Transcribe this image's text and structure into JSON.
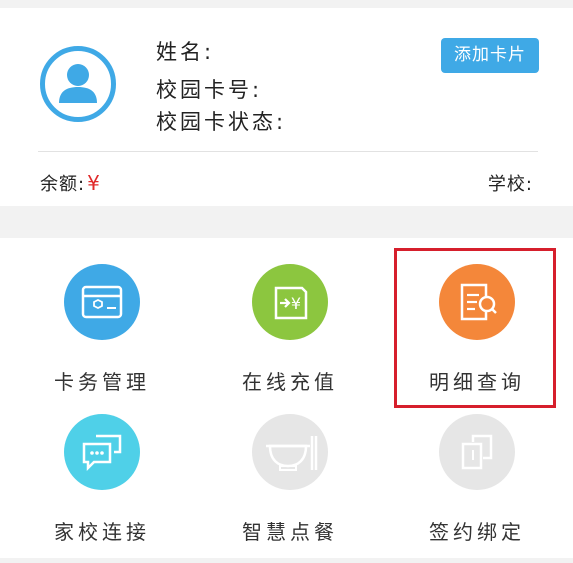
{
  "profile": {
    "name_label": "姓名:",
    "card_no_label": "校园卡号:",
    "card_status_label": "校园卡状态:",
    "add_card_button": "添加卡片",
    "balance_label": "余额:",
    "currency_symbol": "¥",
    "school_label": "学校:"
  },
  "menu": {
    "items": [
      {
        "label": "卡务管理",
        "icon": "card-icon",
        "color": "#3fa9e6"
      },
      {
        "label": "在线充值",
        "icon": "recharge-icon",
        "color": "#8cc63f"
      },
      {
        "label": "明细查询",
        "icon": "details-search-icon",
        "color": "#f4873a"
      },
      {
        "label": "家校连接",
        "icon": "chat-icon",
        "color": "#4fd0e8"
      },
      {
        "label": "智慧点餐",
        "icon": "meal-icon",
        "color": "#e6e6e6"
      },
      {
        "label": "签约绑定",
        "icon": "link-icon",
        "color": "#e6e6e6"
      }
    ]
  },
  "colors": {
    "accent": "#3fa9e6",
    "currency": "#e02a2a",
    "highlight_border": "#d61f2c",
    "disabled": "#e6e6e6"
  }
}
